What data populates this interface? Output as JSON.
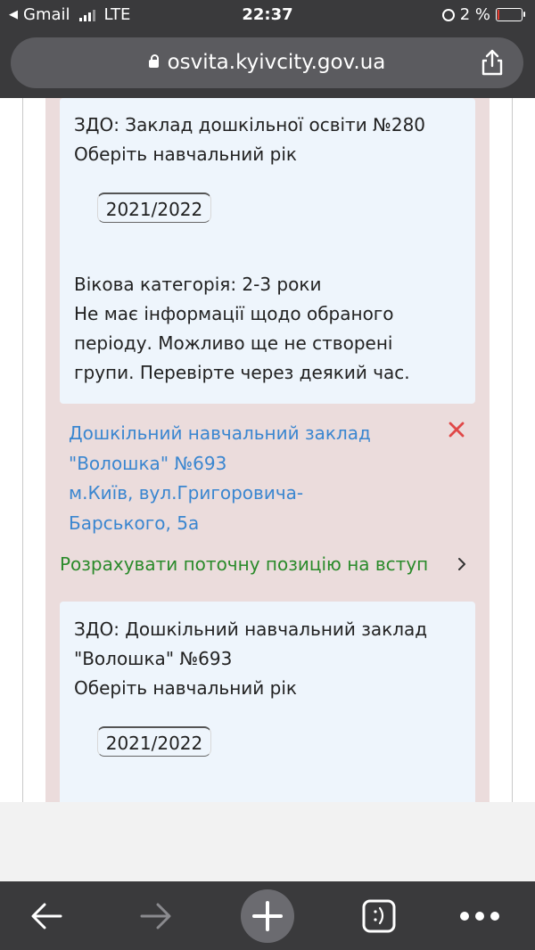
{
  "status_bar": {
    "carrier": "Gmail",
    "network": "LTE",
    "time": "22:37",
    "battery": "2 %",
    "icons": [
      "back-to-app-icon",
      "signal-icon",
      "orientation-lock-icon",
      "battery-icon"
    ]
  },
  "browser": {
    "url": "osvita.kyivcity.gov.ua",
    "icons": [
      "lock-icon",
      "share-icon"
    ]
  },
  "card1": {
    "title": "ЗДО: Заклад дошкільної освіти №280",
    "choose_year": "Оберіть навчальний рік",
    "year_button": "2021/2022",
    "age_category": "Вікова категорія: 2-3 роки",
    "message_lines": [
      "Не має інформації щодо обраного",
      "періоду. Можливо ще не створені",
      "групи. Перевірте через деякий час."
    ]
  },
  "school": {
    "link_lines": [
      "Дошкільний навчальний заклад",
      "\"Волошка\" №693",
      "м.Київ, вул.Григоровича-",
      "Барського, 5а"
    ],
    "calculate_link": "Розрахувати поточну позицію на вступ"
  },
  "card2": {
    "title_lines": [
      "ЗДО: Дошкільний навчальний заклад",
      "\"Волошка\" №693"
    ],
    "choose_year": "Оберіть навчальний рік",
    "year_button": "2021/2022"
  },
  "colors": {
    "system_bar": "#3a3a3c",
    "url_pill": "#5b5b5f",
    "card_bg": "#eef5fc",
    "section_bg": "#ebdcdc",
    "link_blue": "#3a86d0",
    "link_green": "#2a8a2a",
    "remove_red": "#e04848"
  },
  "toolbar": {
    "icons": [
      "back-arrow-icon",
      "forward-arrow-icon",
      "new-tab-plus-icon",
      "tabs-icon",
      "more-icon"
    ]
  }
}
